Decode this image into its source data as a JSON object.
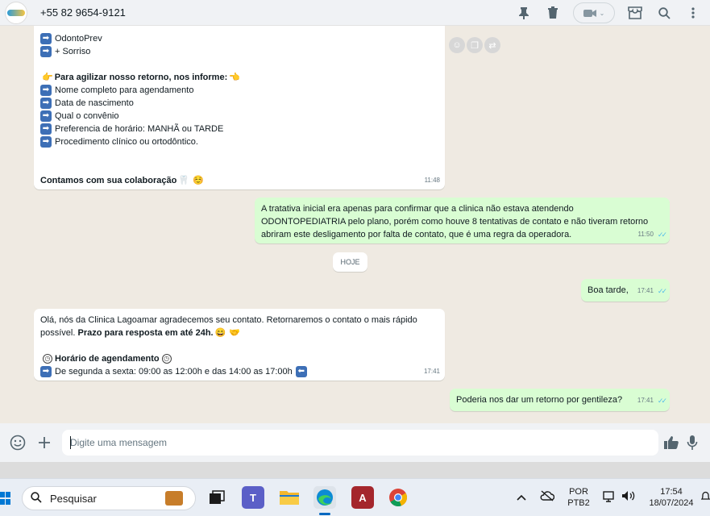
{
  "header": {
    "contact_name": "+55 82 9654-9121",
    "icons": [
      "pin-icon",
      "trash-icon",
      "video-call-icon",
      "shop-icon",
      "search-icon",
      "more-icon"
    ]
  },
  "messages": [
    {
      "direction": "incoming",
      "lines": [
        {
          "icon": "arrow-right-icon",
          "text": "OdontoPrev"
        },
        {
          "icon": "arrow-right-icon",
          "text": "+ Sorriso"
        },
        {
          "icon": "",
          "text": ""
        },
        {
          "icon": "pointing-hand-emoji",
          "text": "Para agilizar nosso retorno, nos informe:",
          "bold": true
        },
        {
          "icon": "arrow-right-icon",
          "text": "Nome completo para agendamento"
        },
        {
          "icon": "arrow-right-icon",
          "text": "Data de nascimento"
        },
        {
          "icon": "arrow-right-icon",
          "text": "Qual o convênio"
        },
        {
          "icon": "arrow-right-icon",
          "text": "Preferencia de horário: MANHÃ ou TARDE"
        },
        {
          "icon": "arrow-right-icon",
          "text": "Procedimento clínico ou ortodôntico."
        },
        {
          "icon": "",
          "text": ""
        },
        {
          "icon": "",
          "text": ""
        },
        {
          "icon": "",
          "text": "Contamos com sua colaboração",
          "bold": true
        }
      ],
      "time": "11:48"
    },
    {
      "direction": "outgoing",
      "text_lines": [
        "A tratativa inicial era apenas para confirmar que a clinica não estava atendendo",
        "ODONTOPEDIATRIA pelo plano, porém como houve 8 tentativas de contato e não tiveram retorno",
        "abriram este desligamento por falta de contato, que é uma regra da operadora."
      ],
      "time": "11:50"
    },
    {
      "direction": "outgoing",
      "text": "Boa tarde,",
      "time": "17:41"
    },
    {
      "direction": "incoming",
      "line1": "Olá, nós da Clinica Lagoamar agradecemos seu contato. Retornaremos o contato o mais rápido",
      "line2_plain": "possível.",
      "line2_bold": "Prazo para resposta em até 24h.",
      "schedule_title": "Horário de agendamento",
      "schedule_text": "De segunda a sexta: 09:00 as 12:00h e das 14:00 as 17:00h",
      "time": "17:41"
    },
    {
      "direction": "outgoing",
      "text": "Poderia nos dar um retorno por gentileza?",
      "time": "17:41"
    }
  ],
  "day_separator": "HOJE",
  "composer": {
    "placeholder": "Digite uma mensagem"
  },
  "taskbar": {
    "search_placeholder": "Pesquisar",
    "language_top": "POR",
    "language_bottom": "PTB2",
    "time": "17:54",
    "date": "18/07/2024"
  },
  "colors": {
    "chat_bg": "#efeae2",
    "outgoing_bubble": "#d9fdd3",
    "incoming_bubble": "#ffffff",
    "read_ticks": "#53bdeb"
  }
}
